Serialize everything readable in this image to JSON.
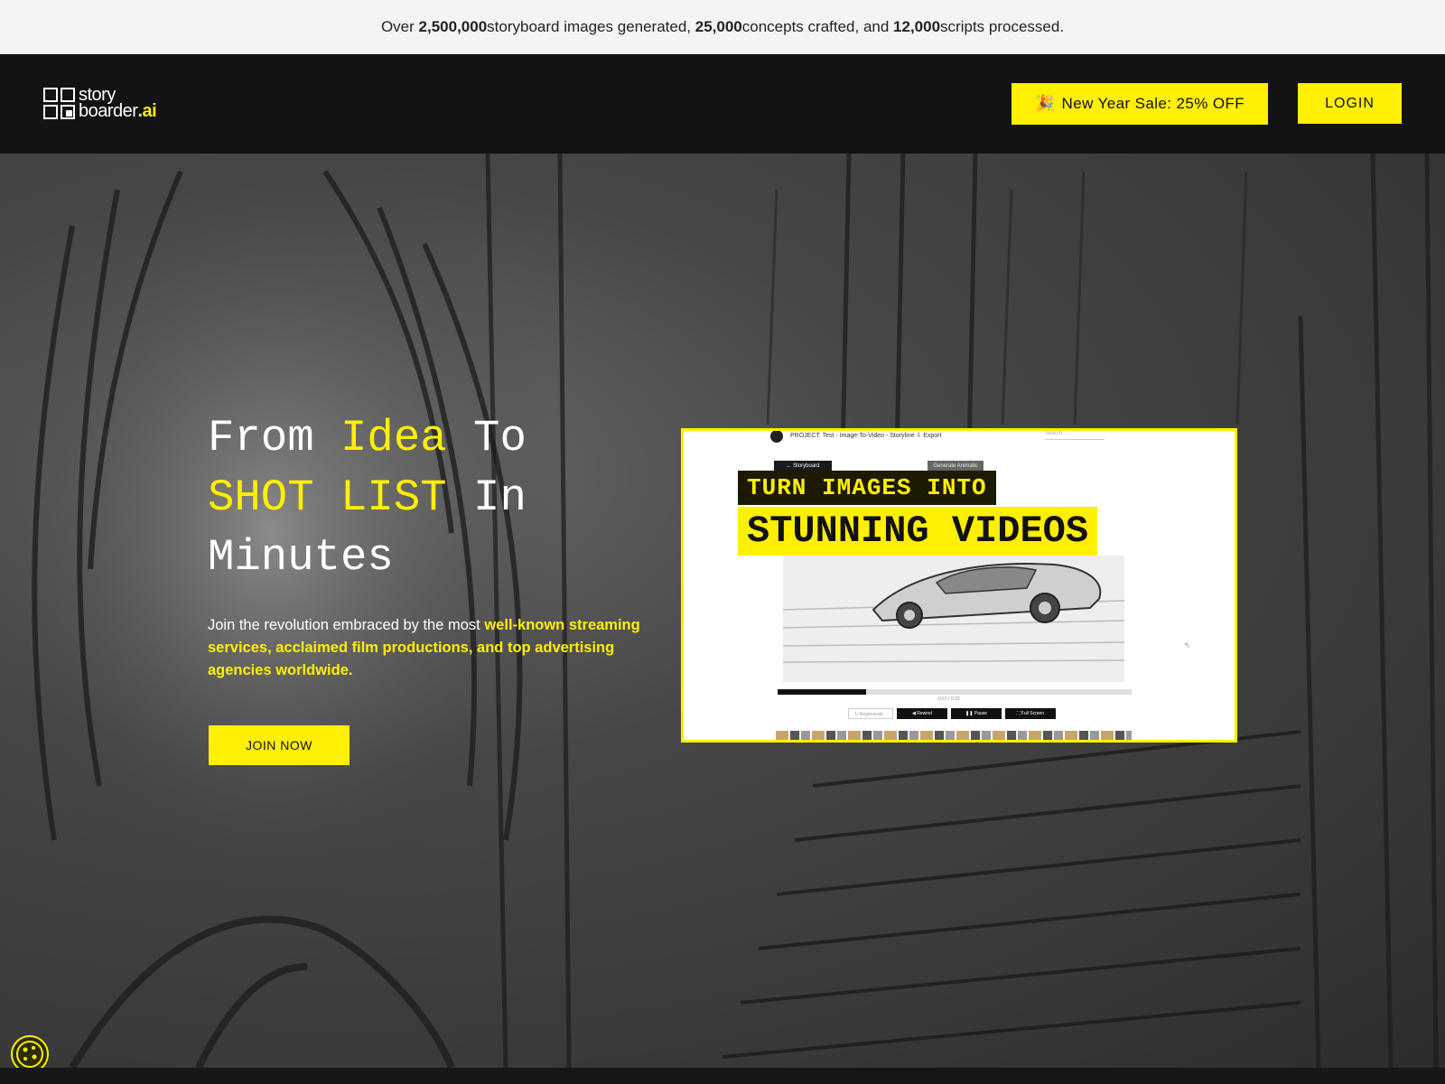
{
  "announcement": {
    "prefix": "Over ",
    "images_count": "2,500,000",
    "images_label": " storyboard images generated, ",
    "concepts_count": "25,000",
    "concepts_label": " concepts crafted, and ",
    "scripts_count": "12,000",
    "scripts_label": " scripts processed."
  },
  "header": {
    "logo_line1": "story",
    "logo_line2": "boarder",
    "logo_suffix": ".ai",
    "sale_icon": "party-popper-icon",
    "sale_emoji": "🎉",
    "sale_label": "New Year Sale: 25% OFF",
    "login_label": "LOGIN"
  },
  "hero": {
    "headline_part1": "From ",
    "headline_idea": "Idea",
    "headline_part2": " To ",
    "headline_shotlist": "SHOT LIST",
    "headline_part3": " In Minutes",
    "sub_part1": "Join the revolution embraced by the most ",
    "sub_highlight": "well-known streaming services, acclaimed film productions, and top advertising agencies worldwide.",
    "join_label": "JOIN NOW"
  },
  "video_panel": {
    "project_label": "PROJECT: Test - Image-To-Video - Storyline",
    "export_label": "⇩ Export",
    "search_placeholder": "Search...",
    "tab_storyboard": "← Storyboard",
    "tab_generate": "Generate Animatic",
    "title_line1": "TURN IMAGES INTO",
    "title_line2": "STUNNING VIDEOS",
    "progress": 0.25,
    "time_label": "0:07 / 0:32",
    "regenerate_label": "↻ Regenerate",
    "rewind_label": "◀ Rewind",
    "pause_label": "❚❚ Pause",
    "fullscreen_label": "⛶ Full Screen"
  },
  "colors": {
    "accent": "#ffef00",
    "header_bg": "#131313",
    "announce_bg": "#f4f4f4"
  },
  "cookie": {
    "icon": "cookie-icon"
  }
}
